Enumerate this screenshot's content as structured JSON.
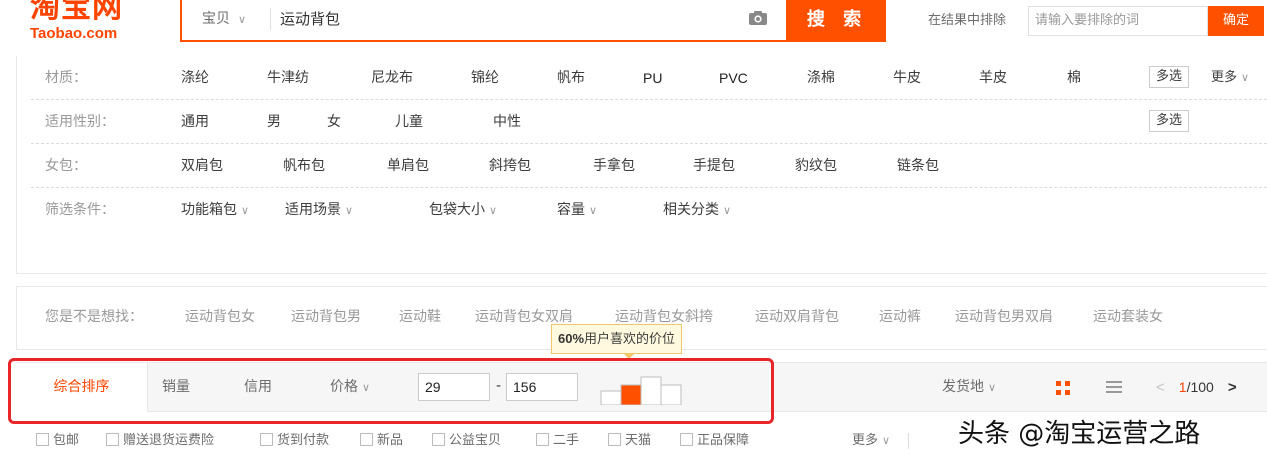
{
  "header": {
    "logo_cn": "淘宝网",
    "logo_en": "Taobao.com",
    "search_type": "宝贝",
    "search_query": "运动背包",
    "search_button": "搜 索",
    "exclude_label": "在结果中排除",
    "exclude_placeholder": "请输入要排除的词",
    "exclude_button": "确定"
  },
  "filters": {
    "material": {
      "label": "材质：",
      "options": [
        "涤纶",
        "牛津纺",
        "尼龙布",
        "锦纶",
        "帆布",
        "PU",
        "PVC",
        "涤棉",
        "牛皮",
        "羊皮",
        "棉"
      ],
      "multi": "多选",
      "more": "更多"
    },
    "gender": {
      "label": "适用性别：",
      "options": [
        "通用",
        "男",
        "女",
        "儿童",
        "中性"
      ],
      "multi": "多选"
    },
    "women_bag": {
      "label": "女包：",
      "options": [
        "双肩包",
        "帆布包",
        "单肩包",
        "斜挎包",
        "手拿包",
        "手提包",
        "豹纹包",
        "链条包"
      ]
    },
    "conditions": {
      "label": "筛选条件：",
      "options": [
        "功能箱包",
        "适用场景",
        "包袋大小",
        "容量",
        "相关分类"
      ]
    }
  },
  "suggest": {
    "label": "您是不是想找：",
    "items": [
      "运动背包女",
      "运动背包男",
      "运动鞋",
      "运动背包女双肩",
      "运动背包女斜挎",
      "运动双肩背包",
      "运动裤",
      "运动背包男双肩",
      "运动套装女"
    ]
  },
  "tooltip": {
    "percent": "60%",
    "text": "用户喜欢的价位"
  },
  "sort": {
    "tabs": [
      "综合排序",
      "销量",
      "信用",
      "价格"
    ],
    "price_min": "29",
    "price_dash": "-",
    "price_max": "156",
    "ship_from": "发货地",
    "page_current": "1",
    "page_total": "/100",
    "price_highlight_fraction": 0.6
  },
  "checks": {
    "items": [
      "包邮",
      "赠送退货运费险",
      "货到付款",
      "新品",
      "公益宝贝",
      "二手",
      "天猫",
      "正品保障"
    ],
    "more": "更多"
  },
  "watermark": "头条 @淘宝运营之路",
  "colors": {
    "accent": "#ff5000",
    "highlight": "#e8262a",
    "tooltip_bg": "#fffadf"
  }
}
